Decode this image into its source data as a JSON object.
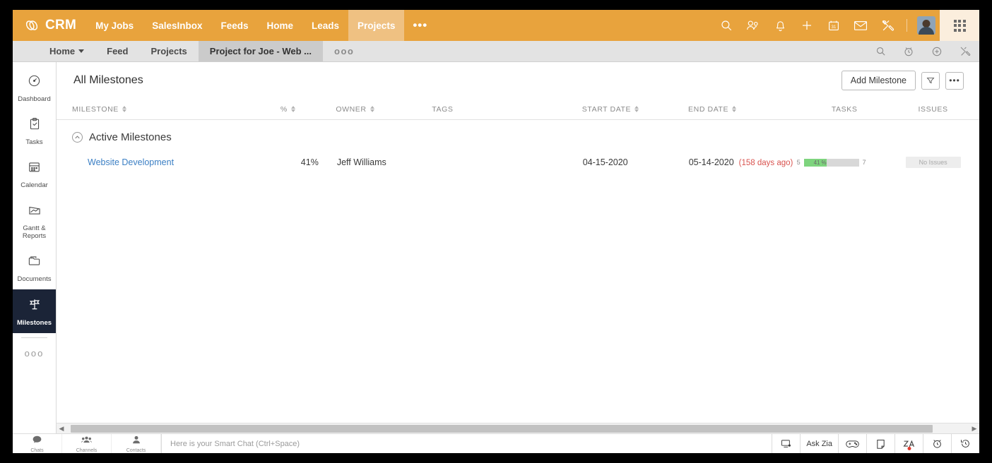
{
  "topbar": {
    "logo_text": "CRM",
    "nav": [
      {
        "label": "My Jobs",
        "active": false
      },
      {
        "label": "SalesInbox",
        "active": false
      },
      {
        "label": "Feeds",
        "active": false
      },
      {
        "label": "Home",
        "active": false
      },
      {
        "label": "Leads",
        "active": false
      },
      {
        "label": "Projects",
        "active": true
      }
    ],
    "overflow": "•••",
    "icons": [
      "search-icon",
      "contacts-icon",
      "bell-icon",
      "plus-icon",
      "calendar-icon",
      "envelope-icon",
      "tools-icon"
    ],
    "calendar_day": "31",
    "accent_color": "#e8a33d",
    "active_tab_color": "#efc182"
  },
  "subbar": {
    "items": [
      {
        "label": "Home",
        "caret": true,
        "active": false
      },
      {
        "label": "Feed",
        "caret": false,
        "active": false
      },
      {
        "label": "Projects",
        "caret": false,
        "active": false
      },
      {
        "label": "Project for Joe - Web ...",
        "caret": false,
        "active": true
      }
    ],
    "overflow": "ooo",
    "icons": [
      "search-icon",
      "timer-icon",
      "plus-circle-icon",
      "tools-icon"
    ]
  },
  "sidebar": {
    "items": [
      {
        "label": "Dashboard",
        "icon": "gauge-icon",
        "active": false
      },
      {
        "label": "Tasks",
        "icon": "clipboard-check-icon",
        "active": false
      },
      {
        "label": "Calendar",
        "icon": "calendar-icon",
        "active": false
      },
      {
        "label": "Gantt &\nReports",
        "icon": "chart-icon",
        "active": false
      },
      {
        "label": "Documents",
        "icon": "folder-icon",
        "active": false
      },
      {
        "label": "Milestones",
        "icon": "milestone-flag-icon",
        "active": true
      }
    ],
    "more": "ooo",
    "active_bg": "#1b2437"
  },
  "page": {
    "title": "All Milestones",
    "add_button": "Add Milestone",
    "filter_icon": "funnel-icon",
    "more_icon": "ellipsis-icon"
  },
  "table": {
    "columns": [
      {
        "label": "MILESTONE",
        "sortable": true
      },
      {
        "label": "%",
        "sortable": true
      },
      {
        "label": "OWNER",
        "sortable": true
      },
      {
        "label": "TAGS",
        "sortable": false
      },
      {
        "label": "START DATE",
        "sortable": true
      },
      {
        "label": "END DATE",
        "sortable": true
      },
      {
        "label": "TASKS",
        "sortable": false
      },
      {
        "label": "ISSUES",
        "sortable": false
      }
    ],
    "group": {
      "label": "Active Milestones",
      "collapse_icon": "chevron-up-circle-icon"
    },
    "rows": [
      {
        "milestone": "Website Development",
        "percent": "41%",
        "owner": "Jeff Williams",
        "tags": "",
        "start_date": "04-15-2020",
        "end_date": "05-14-2020",
        "days_ago": "(158 days ago)",
        "tasks_done": "5",
        "tasks_total": "7",
        "tasks_percent_label": "41",
        "tasks_percent_symbol": "%",
        "tasks_percent_value": 41,
        "issues": "No Issues"
      }
    ]
  },
  "bottombar": {
    "items": [
      {
        "label": "Chats",
        "icon": "chat-bubble-icon"
      },
      {
        "label": "Channels",
        "icon": "channels-icon"
      },
      {
        "label": "Contacts",
        "icon": "contact-icon"
      }
    ],
    "chat_placeholder": "Here is your Smart Chat (Ctrl+Space)",
    "right_items": [
      {
        "label": "",
        "icon": "screen-share-icon"
      },
      {
        "label": "Ask Zia",
        "icon": "ask-zia-label"
      },
      {
        "label": "",
        "icon": "gamepad-icon"
      },
      {
        "label": "",
        "icon": "note-icon"
      },
      {
        "label": "",
        "icon": "zia-icon",
        "badge": true
      },
      {
        "label": "",
        "icon": "alarm-clock-icon"
      },
      {
        "label": "",
        "icon": "history-icon"
      }
    ]
  }
}
